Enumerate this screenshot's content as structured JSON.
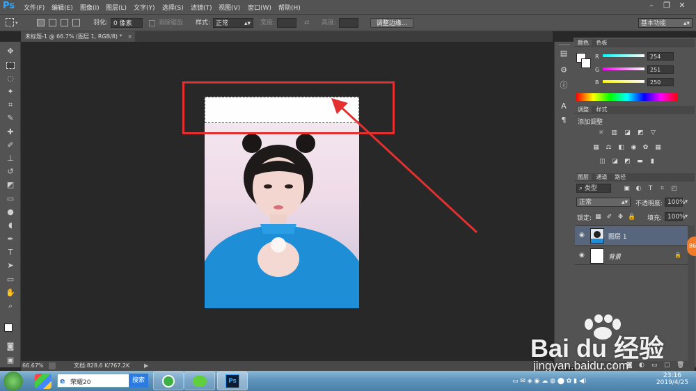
{
  "app": {
    "logo": "Ps"
  },
  "menu": [
    "文件(F)",
    "编辑(E)",
    "图像(I)",
    "图层(L)",
    "文字(Y)",
    "选择(S)",
    "滤镜(T)",
    "视图(V)",
    "窗口(W)",
    "帮助(H)"
  ],
  "options": {
    "feather_label": "羽化:",
    "feather_value": "0 像素",
    "antialias_label": "消除锯齿",
    "style_label": "样式:",
    "style_value": "正常",
    "width_label": "宽度:",
    "height_label": "高度:",
    "refine_button": "调整边缘...",
    "workspace": "基本功能"
  },
  "document": {
    "tab_title": "未标题-1 @ 66.7% (图层 1, RGB/8) *",
    "zoom": "66.67%",
    "doc_info": "文档:828.6 K/767.2K"
  },
  "color_panel": {
    "tabs": [
      "颜色",
      "色板"
    ],
    "channels": [
      {
        "label": "R",
        "value": "254",
        "gradient": [
          "#00fcfa",
          "#fefcfa"
        ]
      },
      {
        "label": "G",
        "value": "251",
        "gradient": [
          "#fe00fa",
          "#fefbfa"
        ]
      },
      {
        "label": "B",
        "value": "250",
        "gradient": [
          "#fefb00",
          "#fefbfa"
        ]
      }
    ]
  },
  "adjust_panel": {
    "tabs": [
      "调整",
      "样式"
    ],
    "title": "添加调整"
  },
  "layers_panel": {
    "tabs": [
      "图层",
      "通道",
      "路径"
    ],
    "filter": "类型",
    "blend_mode": "正常",
    "opacity_label": "不透明度:",
    "opacity_value": "100%",
    "lock_label": "锁定:",
    "fill_label": "填充:",
    "fill_value": "100%",
    "layers": [
      {
        "name": "图层 1",
        "selected": true
      },
      {
        "name": "背景",
        "selected": false
      }
    ]
  },
  "taskbar": {
    "search_value": "荣耀20",
    "search_button": "搜索",
    "ps_label": "Ps",
    "time": "23:16",
    "date": "2019/4/25"
  },
  "badge": "86",
  "watermark": {
    "text": "Bai du 经验",
    "url": "jingyan.baidu.com"
  },
  "colors": {
    "annotation_red": "#e33030",
    "ps_blue": "#31a8ff"
  }
}
